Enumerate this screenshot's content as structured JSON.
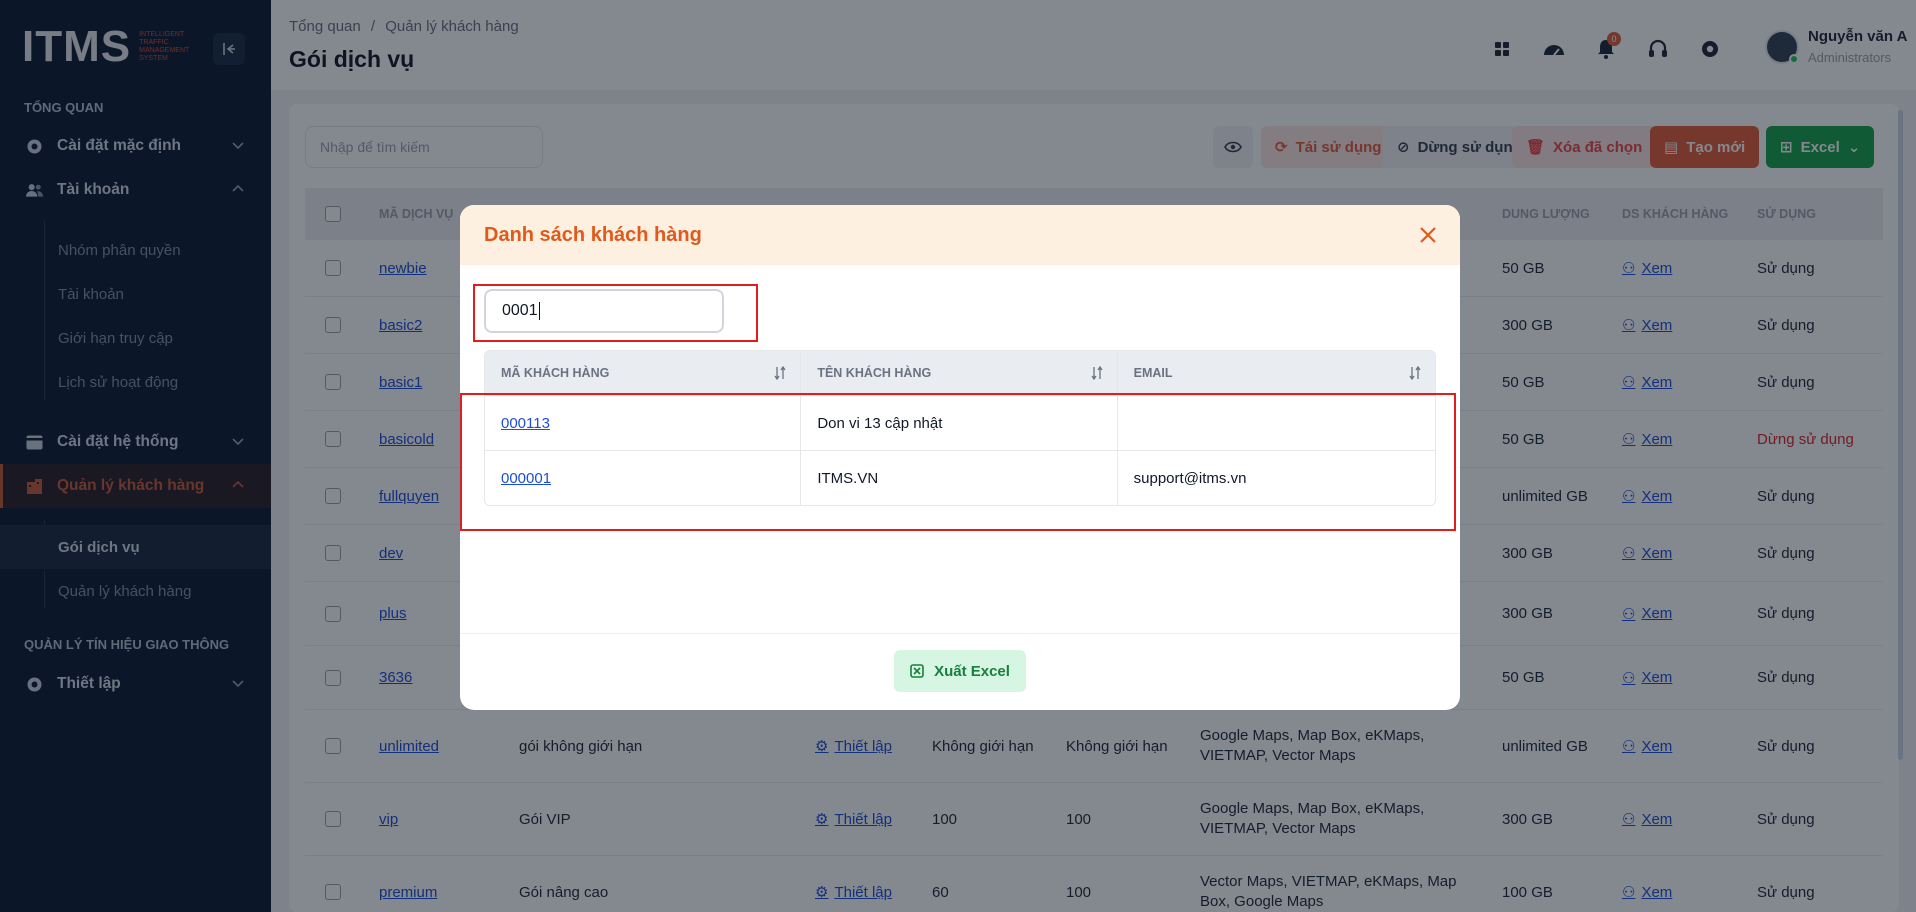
{
  "brand": {
    "logo": "ITMS",
    "tagline": "INTELLIGENT TRAFFIC MANAGEMENT SYSTEM"
  },
  "sidebar": {
    "section_overview": "TỔNG QUAN",
    "default_settings": "Cài đặt mặc định",
    "accounts": "Tài khoản",
    "account_sub": [
      "Nhóm phân quyền",
      "Tài khoản",
      "Giới hạn truy cập",
      "Lịch sử hoạt động"
    ],
    "system_settings": "Cài đặt hệ thống",
    "customer_mgmt": "Quản lý khách hàng",
    "customer_sub": [
      "Gói dịch vụ",
      "Quản lý khách hàng"
    ],
    "section_traffic": "QUẢN LÝ TÍN HIỆU GIAO THÔNG",
    "setup": "Thiết lập"
  },
  "header": {
    "breadcrumb_root": "Tổng quan",
    "breadcrumb_sep": "/",
    "breadcrumb_current": "Quản lý khách hàng",
    "title": "Gói dịch vụ",
    "notification_count": "0",
    "user_name": "Nguyễn văn A",
    "user_role": "Administrators"
  },
  "toolbar": {
    "search_placeholder": "Nhập để tìm kiếm",
    "reuse": "Tái sử dụng",
    "stop": "Dừng sử dụng",
    "delete_selected": "Xóa đã chọn",
    "create": "Tạo mới",
    "excel": "Excel"
  },
  "table": {
    "headers": {
      "code": "MÃ DỊCH VỤ",
      "capacity": "DUNG LƯỢNG",
      "customers": "DS KHÁCH HÀNG",
      "usage": "SỬ DỤNG"
    },
    "view_label": "Xem",
    "setup_label": "Thiết lập",
    "rows": [
      {
        "code": "newbie",
        "capacity": "50 GB",
        "usage": "Sử dụng"
      },
      {
        "code": "basic2",
        "capacity": "300 GB",
        "usage": "Sử dụng"
      },
      {
        "code": "basic1",
        "capacity": "50 GB",
        "usage": "Sử dụng"
      },
      {
        "code": "basicold",
        "capacity": "50 GB",
        "usage": "Dừng sử dụng"
      },
      {
        "code": "fullquyen",
        "capacity": "unlimited GB",
        "usage": "Sử dụng"
      },
      {
        "code": "dev",
        "capacity": "300 GB",
        "usage": "Sử dụng"
      },
      {
        "code": "plus",
        "capacity": "300 GB",
        "usage": "Sử dụng"
      },
      {
        "code": "3636",
        "capacity": "50 GB",
        "usage": "Sử dụng"
      },
      {
        "code": "unlimited",
        "name": "gói không giới hạn",
        "limit_a": "Không giới hạn",
        "limit_b": "Không giới hạn",
        "maps": "Google Maps, Map Box, eKMaps, VIETMAP, Vector Maps",
        "capacity": "unlimited GB",
        "usage": "Sử dụng"
      },
      {
        "code": "vip",
        "name": "Gói VIP",
        "limit_a": "100",
        "limit_b": "100",
        "maps": "Google Maps, Map Box, eKMaps, VIETMAP, Vector Maps",
        "capacity": "300 GB",
        "usage": "Sử dụng"
      },
      {
        "code": "premium",
        "name": "Gói nâng cao",
        "limit_a": "60",
        "limit_b": "100",
        "maps": "Vector Maps, VIETMAP, eKMaps, Map Box, Google Maps",
        "capacity": "100 GB",
        "usage": "Sử dụng"
      }
    ]
  },
  "modal": {
    "title": "Danh sách khách hàng",
    "search_value": "0001",
    "headers": {
      "code": "MÃ KHÁCH HÀNG",
      "name": "TÊN KHÁCH HÀNG",
      "email": "EMAIL"
    },
    "rows": [
      {
        "code": "000113",
        "name": "Don vi 13 cập nhật",
        "email": ""
      },
      {
        "code": "000001",
        "name": "ITMS.VN",
        "email": "support@itms.vn"
      }
    ],
    "export_label": "Xuất Excel"
  },
  "colors": {
    "sidebar_bg": "#0d1b33",
    "accent": "#e05a1c",
    "link": "#1d4ed8",
    "highlight": "#e11d1d",
    "export_green": "#16803c"
  }
}
